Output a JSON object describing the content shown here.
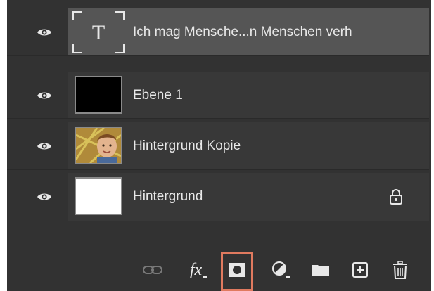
{
  "layers": [
    {
      "name": "Ich mag Mensche...n Menschen verh",
      "thumb": "text",
      "thumb_glyph": "T",
      "visible": true,
      "selected": true,
      "locked": false
    },
    {
      "name": "Ebene 1",
      "thumb": "black",
      "visible": true,
      "selected": false,
      "locked": false
    },
    {
      "name": "Hintergrund Kopie",
      "thumb": "photo",
      "visible": true,
      "selected": false,
      "locked": false
    },
    {
      "name": "Hintergrund",
      "thumb": "white",
      "visible": true,
      "selected": false,
      "locked": true
    }
  ],
  "toolbar": {
    "fx_label": "fx",
    "buttons": [
      "link-layers",
      "layer-style",
      "add-mask",
      "adjustment-layer",
      "new-group",
      "new-layer",
      "delete-layer"
    ],
    "highlighted": "add-mask"
  },
  "colors": {
    "panel": "#323232",
    "row": "#383838",
    "row_selected": "#555555",
    "highlight": "#e07a5f"
  }
}
